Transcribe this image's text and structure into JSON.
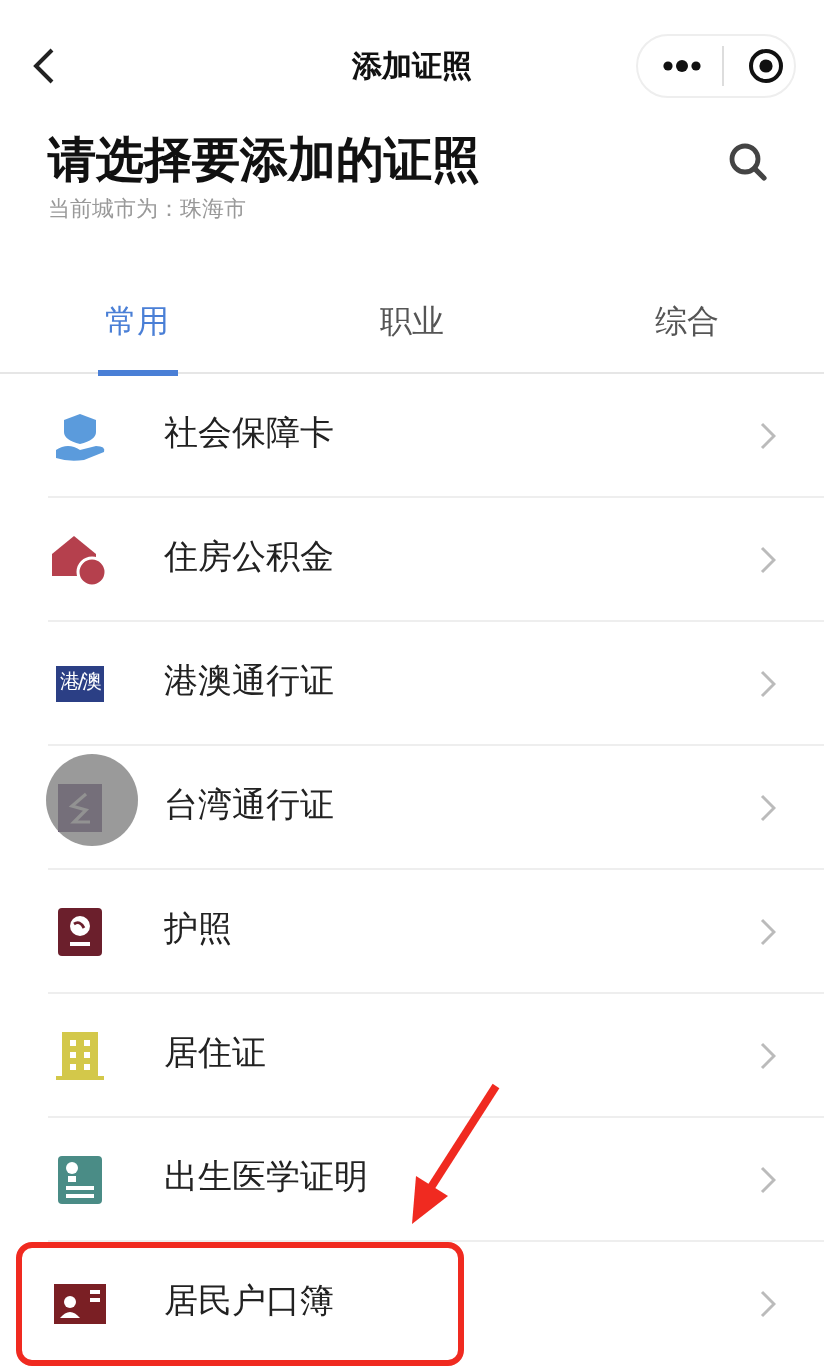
{
  "nav_bar": {
    "title": "添加证照"
  },
  "header": {
    "title": "请选择要添加的证照",
    "subtitle": "当前城市为：珠海市"
  },
  "tabs": [
    {
      "label": "常用",
      "selected": true
    },
    {
      "label": "职业",
      "selected": false
    },
    {
      "label": "综合",
      "selected": false
    }
  ],
  "items": [
    {
      "kind": "social",
      "label": "社会保障卡",
      "highlighted": false
    },
    {
      "kind": "housing",
      "label": "住房公积金",
      "highlighted": false
    },
    {
      "kind": "hkmacau",
      "label": "港澳通行证",
      "icon_text": "港/澳",
      "highlighted": false
    },
    {
      "kind": "taiwan",
      "label": "台湾通行证",
      "highlighted": false
    },
    {
      "kind": "passport",
      "label": "护照",
      "highlighted": false
    },
    {
      "kind": "residence",
      "label": "居住证",
      "highlighted": false
    },
    {
      "kind": "birth",
      "label": "出生医学证明",
      "highlighted": false
    },
    {
      "kind": "household",
      "label": "居民户口簿",
      "highlighted": true
    }
  ],
  "floating_button": {
    "visible": true
  },
  "annotation_arrow": {
    "visible": true
  }
}
